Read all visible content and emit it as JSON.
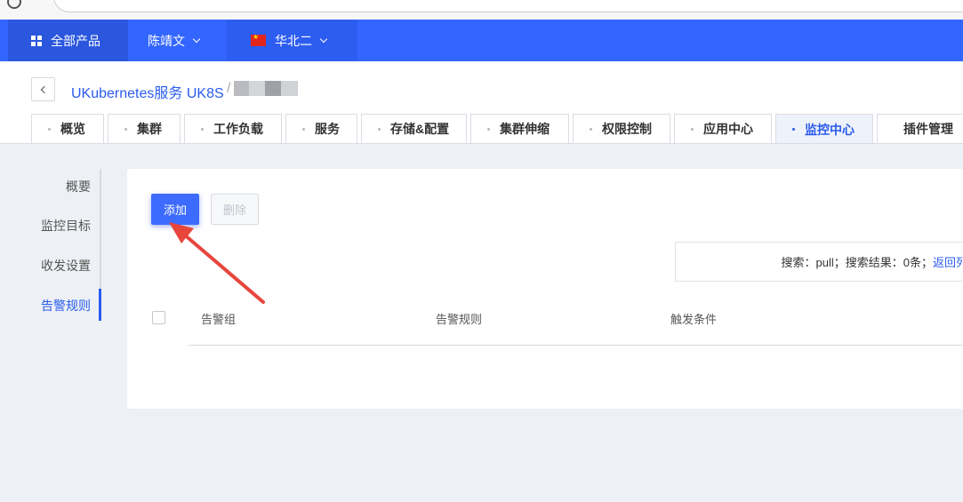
{
  "topnav": {
    "products_label": "全部产品",
    "user_label": "陈靖文",
    "region_label": "华北二"
  },
  "header": {
    "title": "UKubernetes服务 UK8S",
    "separator": "/"
  },
  "tabs": [
    {
      "label": "概览"
    },
    {
      "label": "集群"
    },
    {
      "label": "工作负载"
    },
    {
      "label": "服务"
    },
    {
      "label": "存储&配置"
    },
    {
      "label": "集群伸缩"
    },
    {
      "label": "权限控制"
    },
    {
      "label": "应用中心"
    },
    {
      "label": "监控中心",
      "active": true
    },
    {
      "label": "插件管理"
    }
  ],
  "sidemenu": {
    "items": [
      {
        "label": "概要"
      },
      {
        "label": "监控目标"
      },
      {
        "label": "收发设置"
      },
      {
        "label": "告警规则",
        "active": true
      }
    ]
  },
  "toolbar": {
    "add_label": "添加",
    "delete_label": "删除"
  },
  "search": {
    "text": "搜索：pull；搜索结果：0条；",
    "link": "返回列"
  },
  "table": {
    "columns": [
      "告警组",
      "告警规则",
      "触发条件"
    ]
  },
  "colors": {
    "accent": "#3366ff",
    "link": "#2a5bef",
    "annotation": "#e8453c"
  }
}
